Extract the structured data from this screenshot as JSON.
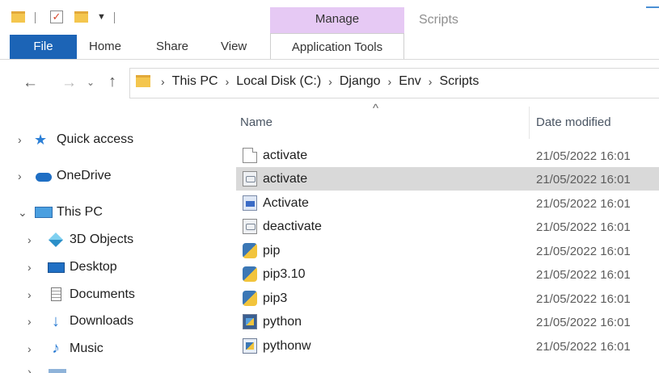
{
  "window": {
    "manage_tab": "Manage",
    "title": "Scripts"
  },
  "ribbon": {
    "tabs": [
      "File",
      "Home",
      "Share",
      "View",
      "Application Tools"
    ]
  },
  "address": {
    "crumbs": [
      "This PC",
      "Local Disk (C:)",
      "Django",
      "Env",
      "Scripts"
    ]
  },
  "nav_pane": {
    "items": [
      {
        "label": "Quick access",
        "icon": "star-icon"
      },
      {
        "label": "OneDrive",
        "icon": "cloud-icon"
      },
      {
        "label": "This PC",
        "icon": "computer-icon"
      },
      {
        "label": "3D Objects",
        "icon": "cube-icon"
      },
      {
        "label": "Desktop",
        "icon": "desktop-icon"
      },
      {
        "label": "Documents",
        "icon": "documents-icon"
      },
      {
        "label": "Downloads",
        "icon": "download-icon"
      },
      {
        "label": "Music",
        "icon": "music-icon"
      }
    ]
  },
  "file_list": {
    "columns": [
      "Name",
      "Date modified"
    ],
    "files": [
      {
        "name": "activate",
        "date": "21/05/2022 16:01",
        "icon": "file-icon"
      },
      {
        "name": "activate",
        "date": "21/05/2022 16:01",
        "icon": "batch-file-icon",
        "selected": true
      },
      {
        "name": "Activate",
        "date": "21/05/2022 16:01",
        "icon": "powershell-script-icon"
      },
      {
        "name": "deactivate",
        "date": "21/05/2022 16:01",
        "icon": "batch-file-icon"
      },
      {
        "name": "pip",
        "date": "21/05/2022 16:01",
        "icon": "python-file-icon"
      },
      {
        "name": "pip3.10",
        "date": "21/05/2022 16:01",
        "icon": "python-file-icon"
      },
      {
        "name": "pip3",
        "date": "21/05/2022 16:01",
        "icon": "python-file-icon"
      },
      {
        "name": "python",
        "date": "21/05/2022 16:01",
        "icon": "python-exe-icon"
      },
      {
        "name": "pythonw",
        "date": "21/05/2022 16:01",
        "icon": "pythonw-exe-icon"
      }
    ]
  },
  "colors": {
    "file_tab": "#1c64b6",
    "manage_tab": "#e6c9f4",
    "selection": "#d9d9d9"
  }
}
